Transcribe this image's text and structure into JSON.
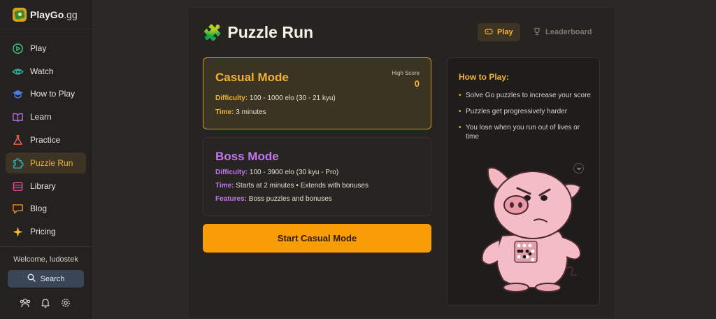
{
  "brand": {
    "name": "PlayGo",
    "tld": ".gg"
  },
  "sidebar": {
    "items": [
      {
        "label": "Play",
        "icon": "play-circle-icon",
        "color": "#3ec27a"
      },
      {
        "label": "Watch",
        "icon": "eye-icon",
        "color": "#2fb3a6"
      },
      {
        "label": "How to Play",
        "icon": "graduation-cap-icon",
        "color": "#4a7fe0"
      },
      {
        "label": "Learn",
        "icon": "book-icon",
        "color": "#b46ee8"
      },
      {
        "label": "Practice",
        "icon": "flask-icon",
        "color": "#f06a3a"
      },
      {
        "label": "Puzzle Run",
        "icon": "puzzle-icon",
        "color": "#27b5c9",
        "active": true
      },
      {
        "label": "Library",
        "icon": "library-icon",
        "color": "#e64c8e"
      },
      {
        "label": "Blog",
        "icon": "chat-bubble-icon",
        "color": "#f08a24"
      },
      {
        "label": "Pricing",
        "icon": "sparkle-icon",
        "color": "#f2b234"
      }
    ],
    "welcome": "Welcome, ludostek",
    "search_label": "Search"
  },
  "main": {
    "title_emoji": "🧩",
    "title": "Puzzle Run",
    "tabs": [
      {
        "label": "Play",
        "active": true
      },
      {
        "label": "Leaderboard",
        "active": false
      }
    ],
    "casual": {
      "title": "Casual Mode",
      "high_score_label": "High Score",
      "high_score": "0",
      "difficulty_label": "Difficulty:",
      "difficulty": "100 - 1000 elo (30 - 21 kyu)",
      "time_label": "Time:",
      "time": "3 minutes"
    },
    "boss": {
      "title": "Boss Mode",
      "difficulty_label": "Difficulty:",
      "difficulty": "100 - 3900 elo (30 kyu - Pro)",
      "time_label": "Time:",
      "time": "Starts at 2 minutes • Extends with bonuses",
      "features_label": "Features:",
      "features": "Boss puzzles and bonuses"
    },
    "start_button": "Start Casual Mode",
    "how_to_play": {
      "title": "How to Play:",
      "items": [
        "Solve Go puzzles to increase your score",
        "Puzzles get progressively harder",
        "You lose when you run out of lives or time"
      ]
    }
  },
  "colors": {
    "accent": "#f2b234",
    "boss": "#c376f0",
    "start_button": "#f89c07"
  }
}
